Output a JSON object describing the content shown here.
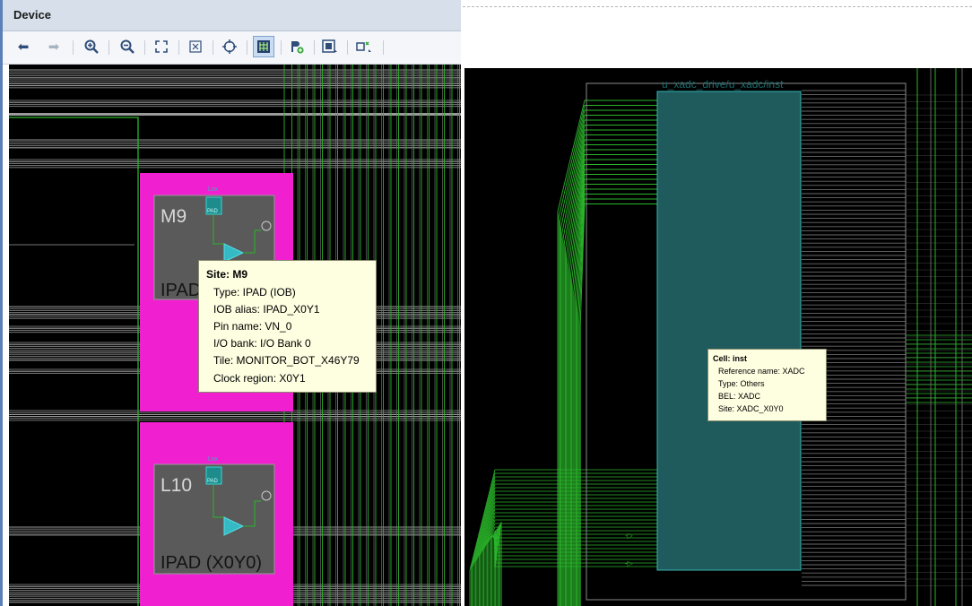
{
  "panel": {
    "title": "Device"
  },
  "toolbar": {
    "buttons": [
      {
        "name": "back",
        "icon": "arrow-left-icon"
      },
      {
        "name": "forward",
        "icon": "arrow-right-icon"
      },
      {
        "name": "zoom-in",
        "icon": "zoom-in-icon"
      },
      {
        "name": "zoom-out",
        "icon": "zoom-out-icon"
      },
      {
        "name": "zoom-fit",
        "icon": "expand-icon"
      },
      {
        "name": "zoom-selected",
        "icon": "fit-selection-icon"
      },
      {
        "name": "auto-fit",
        "icon": "crosshair-icon"
      },
      {
        "name": "routing-resources",
        "icon": "routing-icon",
        "active": true
      },
      {
        "name": "add-pblock",
        "icon": "pblock-add-icon"
      },
      {
        "name": "draw-pblock",
        "icon": "pblock-draw-icon"
      },
      {
        "name": "site-constraint",
        "icon": "constraint-icon"
      }
    ]
  },
  "sites": {
    "m9": {
      "name": "M9",
      "label": "IPAD",
      "small_label": "Lxx",
      "pad_label": "PAD"
    },
    "l10": {
      "name": "L10",
      "label": "IPAD (X0Y0)",
      "small_label": "Lxx",
      "pad_label": "PAD"
    }
  },
  "tooltip_site": {
    "heading": "Site: M9",
    "lines": [
      "Type: IPAD (IOB)",
      "IOB alias: IPAD_X0Y1",
      "Pin name: VN_0",
      "I/O bank: I/O Bank 0",
      "Tile: MONITOR_BOT_X46Y79",
      "Clock region: X0Y1"
    ]
  },
  "cell": {
    "label": "u_xadc_drive/u_xadc/inst"
  },
  "tooltip_cell": {
    "heading": "Cell: inst",
    "lines": [
      "Reference name: XADC",
      "Type: Others",
      "BEL: XADC",
      "Site: XADC_X0Y0"
    ]
  },
  "colors": {
    "canvas": "#000000",
    "net": "#2ab52a",
    "site_highlight": "#f01fcf",
    "site_box": "#5a5a5a",
    "cell_fill": "#1f5b5c",
    "cell_outline": "#36b6b6",
    "tooltip_bg": "#fefee1"
  }
}
